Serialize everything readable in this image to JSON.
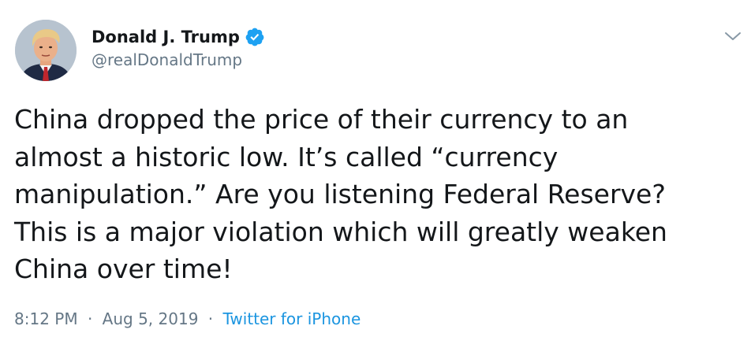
{
  "author": {
    "display_name": "Donald J. Trump",
    "handle": "@realDonaldTrump",
    "verified": true,
    "avatar_icon": "profile-photo"
  },
  "tweet": {
    "lines": [
      "China dropped the price of their currency to an",
      "almost a historic low. It’s called “currency",
      "manipulation.” Are you listening Federal Reserve?",
      "This is a major violation which will greatly weaken",
      "China over time!"
    ]
  },
  "meta": {
    "time": "8:12 PM",
    "separator": "·",
    "date": "Aug 5, 2019",
    "source": "Twitter for iPhone"
  },
  "icons": {
    "verified": "verified-badge-icon",
    "menu": "chevron-down-icon"
  },
  "colors": {
    "text": "#14171a",
    "secondary": "#657786",
    "link": "#1b95e0",
    "verified": "#1da1f2"
  }
}
